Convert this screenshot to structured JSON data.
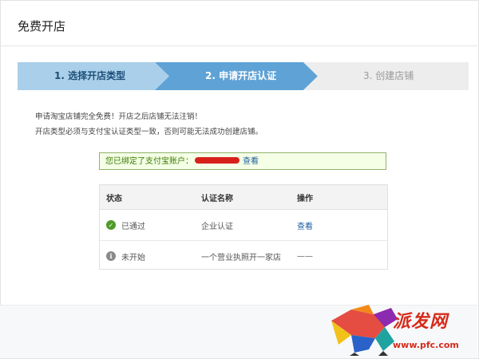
{
  "page": {
    "title": "免费开店"
  },
  "steps": [
    {
      "label": "1. 选择开店类型",
      "state": "done"
    },
    {
      "label": "2. 申请开店认证",
      "state": "current"
    },
    {
      "label": "3. 创建店铺",
      "state": "pending"
    }
  ],
  "notes": {
    "line1": "申请淘宝店铺完全免费！开店之后店铺无法注销！",
    "line2": "开店类型必须与支付宝认证类型一致，否则可能无法成功创建店铺。"
  },
  "alipay": {
    "text": "您已绑定了支付宝账户：",
    "link": "查看"
  },
  "table": {
    "headers": [
      "状态",
      "认证名称",
      "操作"
    ],
    "rows": [
      {
        "status": "已通过",
        "status_icon": "check-circle-icon",
        "name": "企业认证",
        "action": "查看"
      },
      {
        "status": "未开始",
        "status_icon": "info-circle-icon",
        "name": "一个营业执照开一家店",
        "action": "——"
      }
    ]
  },
  "watermark": {
    "text": "派发网",
    "url": "www.pfc.com"
  },
  "colors": {
    "step_done": "#a9cfea",
    "step_current": "#5ea2d6",
    "step_pending": "#ededed",
    "success_green": "#4f9a28",
    "link_blue": "#1f5fa0",
    "watermark_red": "#d62a1a"
  }
}
